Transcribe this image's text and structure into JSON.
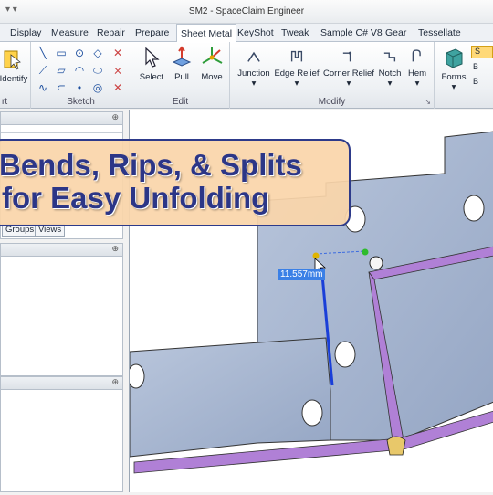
{
  "window": {
    "title": "SM2 - SpaceClaim Engineer",
    "quick_access": "▾  ▾"
  },
  "tabs": [
    {
      "label": "Display"
    },
    {
      "label": "Measure"
    },
    {
      "label": "Repair"
    },
    {
      "label": "Prepare"
    },
    {
      "label": "Sheet Metal",
      "active": true
    },
    {
      "label": "KeyShot"
    },
    {
      "label": "Tweak"
    },
    {
      "label": "Sample C# V8"
    },
    {
      "label": "Gear"
    },
    {
      "label": "Tessellate"
    }
  ],
  "ribbon": {
    "identify_label": "Identify",
    "left_group_label": "rt",
    "sketch_group_label": "Sketch",
    "edit": {
      "select_label": "Select",
      "pull_label": "Pull",
      "move_label": "Move",
      "group_label": "Edit"
    },
    "modify": {
      "junction_label": "Junction",
      "edge_relief_label": "Edge Relief",
      "corner_relief_label": "Corner Relief",
      "notch_label": "Notch",
      "hem_label": "Hem",
      "group_label": "Modify"
    },
    "forms_label": "Forms",
    "right_item_s": "S",
    "right_item_b1": "B",
    "right_item_b2": "B"
  },
  "panel": {
    "tabs": [
      {
        "label": "Groups"
      },
      {
        "label": "Views"
      }
    ]
  },
  "viewport": {
    "dimension_value": "11.557mm"
  },
  "banner": {
    "line1": "Bends, Rips, & Splits",
    "line2": "for Easy Unfolding"
  },
  "colors": {
    "part_face": "#a4b3cc",
    "bend": "#a879c9",
    "banner_bg": "#f8d3a8",
    "banner_text": "#2c3687",
    "dimension_bg": "#3b80e6"
  }
}
